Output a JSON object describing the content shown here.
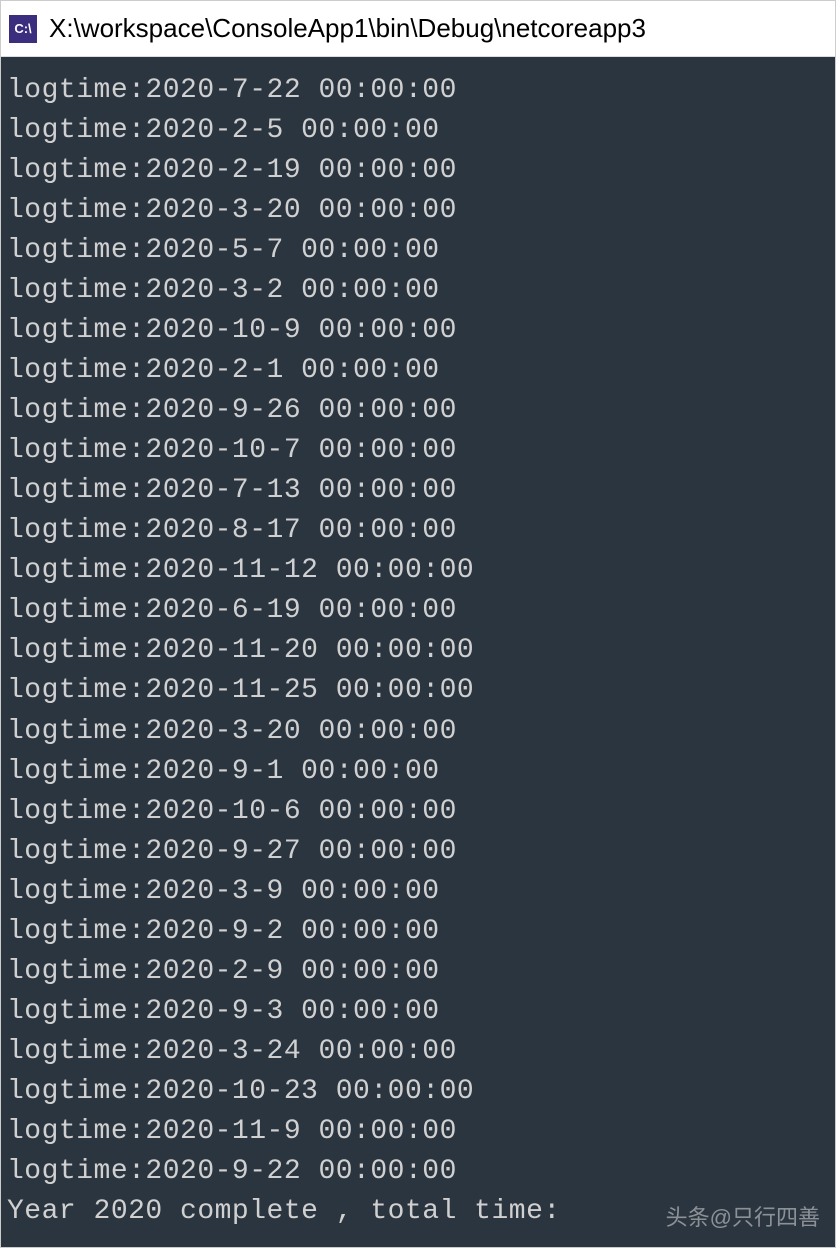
{
  "titlebar": {
    "icon_label": "C:\\",
    "title": "X:\\workspace\\ConsoleApp1\\bin\\Debug\\netcoreapp3"
  },
  "console": {
    "lines": [
      "logtime:2020-7-22 00:00:00",
      "logtime:2020-2-5 00:00:00",
      "logtime:2020-2-19 00:00:00",
      "logtime:2020-3-20 00:00:00",
      "logtime:2020-5-7 00:00:00",
      "logtime:2020-3-2 00:00:00",
      "logtime:2020-10-9 00:00:00",
      "logtime:2020-2-1 00:00:00",
      "logtime:2020-9-26 00:00:00",
      "logtime:2020-10-7 00:00:00",
      "logtime:2020-7-13 00:00:00",
      "logtime:2020-8-17 00:00:00",
      "logtime:2020-11-12 00:00:00",
      "logtime:2020-6-19 00:00:00",
      "logtime:2020-11-20 00:00:00",
      "logtime:2020-11-25 00:00:00",
      "logtime:2020-3-20 00:00:00",
      "logtime:2020-9-1 00:00:00",
      "logtime:2020-10-6 00:00:00",
      "logtime:2020-9-27 00:00:00",
      "logtime:2020-3-9 00:00:00",
      "logtime:2020-9-2 00:00:00",
      "logtime:2020-2-9 00:00:00",
      "logtime:2020-9-3 00:00:00",
      "logtime:2020-3-24 00:00:00",
      "logtime:2020-10-23 00:00:00",
      "logtime:2020-11-9 00:00:00",
      "logtime:2020-9-22 00:00:00",
      "Year 2020 complete , total time:"
    ]
  },
  "watermark": {
    "text": "头条@只行四善"
  }
}
